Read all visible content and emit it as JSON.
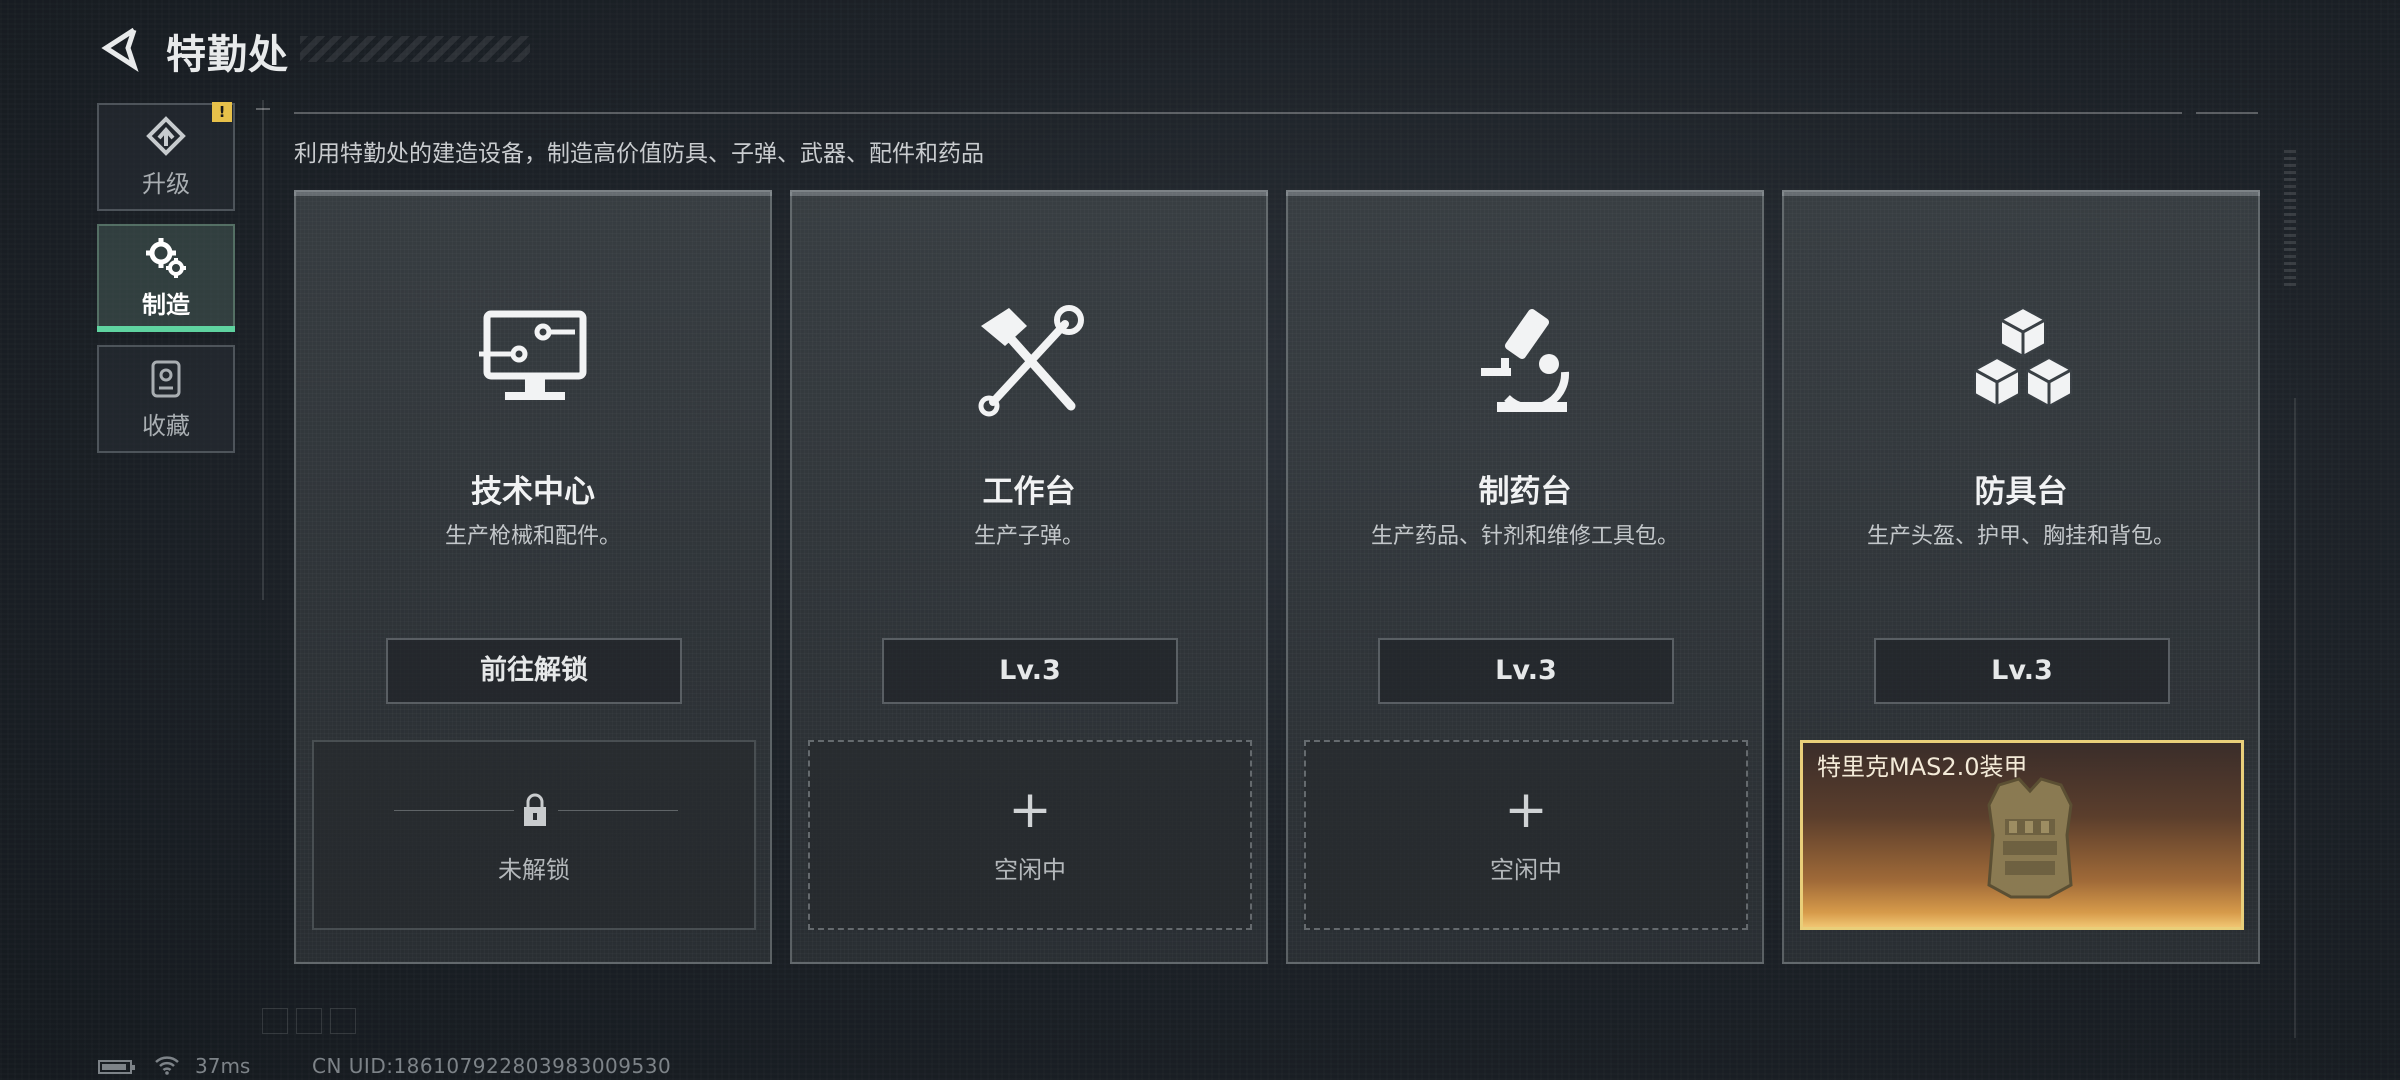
{
  "header": {
    "title": "特勤处"
  },
  "sidebar": {
    "items": [
      {
        "label": "升级",
        "icon": "upgrade-icon",
        "alert": "!"
      },
      {
        "label": "制造",
        "icon": "gear-icon",
        "active": true
      },
      {
        "label": "收藏",
        "icon": "collection-icon"
      }
    ]
  },
  "main": {
    "description": "利用特勤处的建造设备，制造高价值防具、子弹、武器、配件和药品",
    "cards": [
      {
        "title": "技术中心",
        "desc": "生产枪械和配件。",
        "button": "前往解锁",
        "icon": "computer-icon",
        "slot_status": "未解锁",
        "slot_icon": "lock-icon"
      },
      {
        "title": "工作台",
        "desc": "生产子弹。",
        "button": "Lv.3",
        "icon": "hammer-wrench-icon",
        "slot_plus": "+",
        "slot_status": "空闲中"
      },
      {
        "title": "制药台",
        "desc": "生产药品、针剂和维修工具包。",
        "button": "Lv.3",
        "icon": "microscope-icon",
        "slot_plus": "+",
        "slot_status": "空闲中"
      },
      {
        "title": "防具台",
        "desc": "生产头盔、护甲、胸挂和背包。",
        "button": "Lv.3",
        "icon": "cubes-icon",
        "slot_product": "特里克MAS2.0装甲"
      }
    ]
  },
  "footer": {
    "ping": "37ms",
    "uid": "CN UID:186107922803983009530"
  },
  "colors": {
    "accent": "#5fd3a0",
    "alert": "#e8c14a",
    "product_border": "#e9cf7a"
  }
}
